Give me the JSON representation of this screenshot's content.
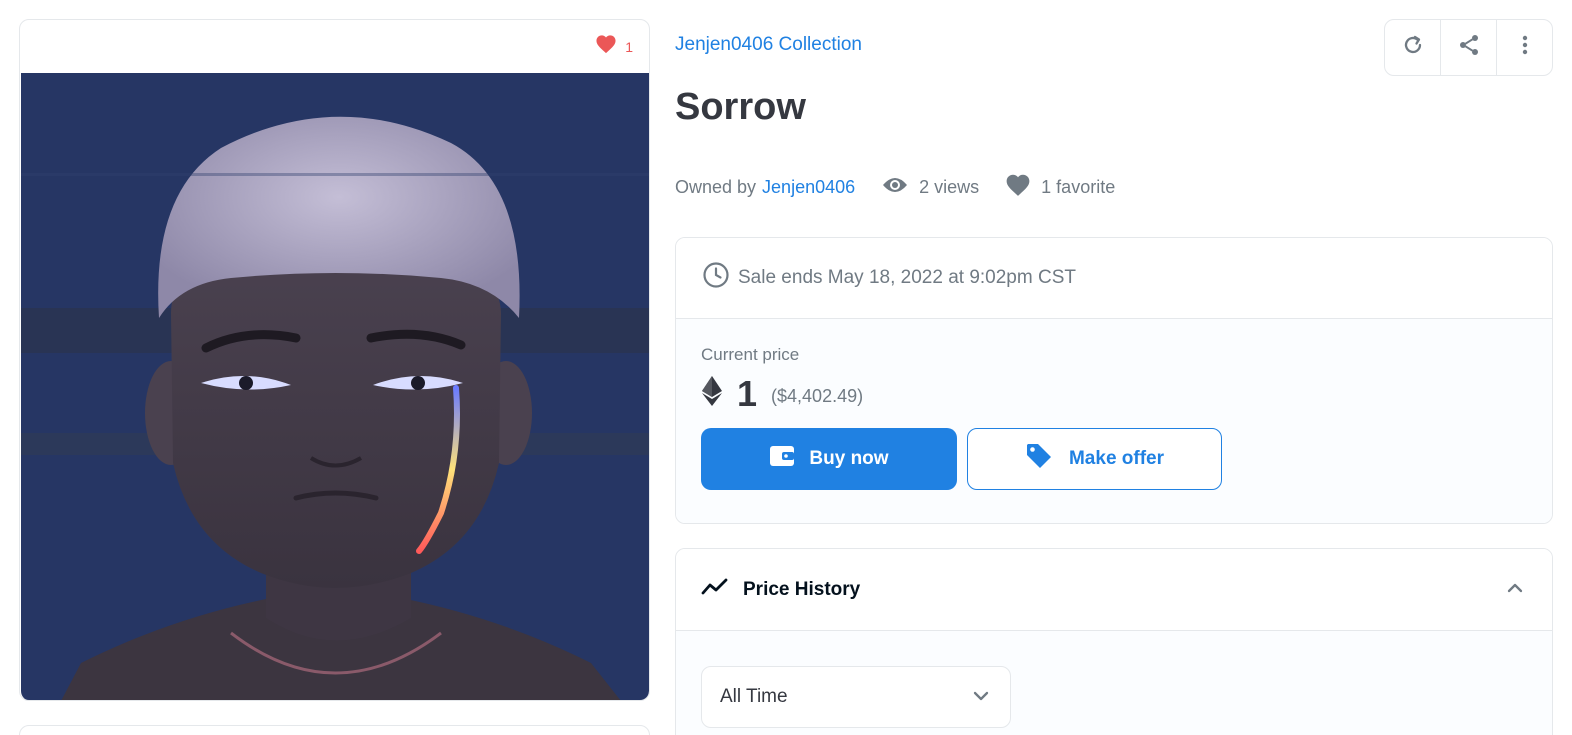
{
  "asset": {
    "favorite_count": "1",
    "collection_name": "Jenjen0406 Collection",
    "title": "Sorrow",
    "owned_by_label": "Owned by",
    "owner": "Jenjen0406",
    "views": "2 views",
    "favorites": "1 favorite"
  },
  "sale": {
    "ends_text": "Sale ends May 18, 2022 at 9:02pm CST",
    "current_price_label": "Current price",
    "price_eth": "1",
    "price_usd": "($4,402.49)",
    "buy_label": "Buy now",
    "offer_label": "Make offer"
  },
  "price_history": {
    "title": "Price History",
    "range_selected": "All Time"
  },
  "colors": {
    "accent": "#2081e2",
    "heart": "#eb5757",
    "muted_text": "#707a83",
    "border": "#e5e8eb"
  },
  "icons": [
    "heart-icon",
    "refresh-icon",
    "share-icon",
    "more-vertical-icon",
    "eye-icon",
    "clock-icon",
    "ethereum-icon",
    "wallet-icon",
    "tag-icon",
    "trend-line-icon",
    "chevron-up-icon",
    "chevron-down-icon"
  ]
}
